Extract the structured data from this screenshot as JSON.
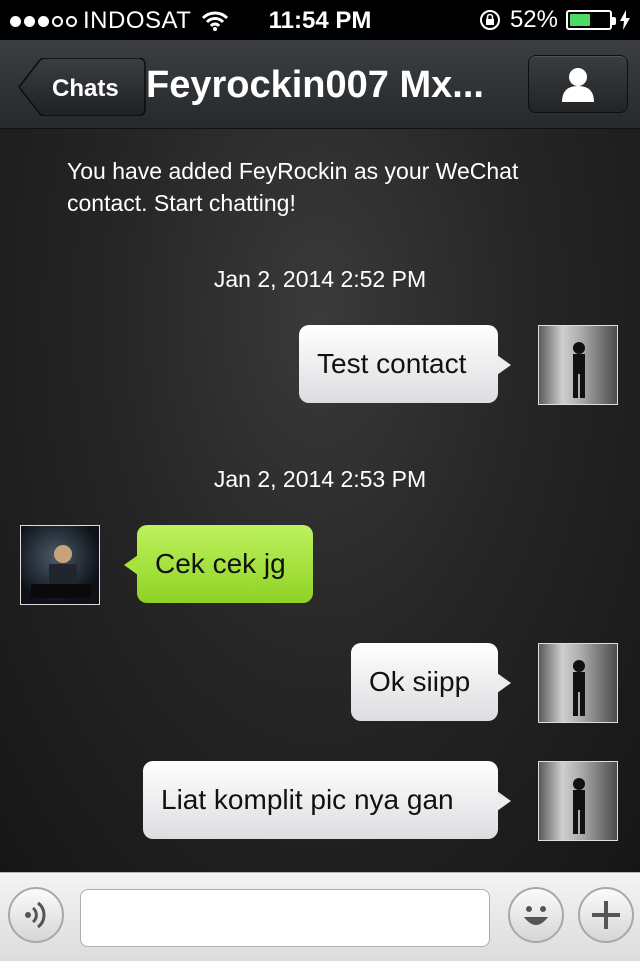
{
  "status_bar": {
    "carrier": "INDOSAT",
    "time": "11:54 PM",
    "battery": "52%",
    "battery_level": 0.52,
    "signal_bars_filled": 3,
    "signal_bars_total": 5
  },
  "nav": {
    "back_label": "Chats",
    "title": "Feyrockin007 Mx..."
  },
  "chat": {
    "system_message": "You have added FeyRockin as your WeChat contact. Start chatting!",
    "timestamps": [
      "Jan 2, 2014 2:52 PM",
      "Jan 2, 2014 2:53 PM"
    ],
    "messages": [
      {
        "direction": "out",
        "text": "Test contact"
      },
      {
        "direction": "in",
        "text": "Cek cek jg"
      },
      {
        "direction": "out",
        "text": "Ok siipp"
      },
      {
        "direction": "out",
        "text": "Liat komplit pic nya gan"
      }
    ]
  },
  "input": {
    "placeholder": "",
    "icons": [
      "voice-icon",
      "emoji-icon",
      "plus-icon"
    ]
  },
  "colors": {
    "bubble_out": "#e6e7ea",
    "bubble_in": "#a4e03a",
    "battery_fill": "#4cd964"
  }
}
